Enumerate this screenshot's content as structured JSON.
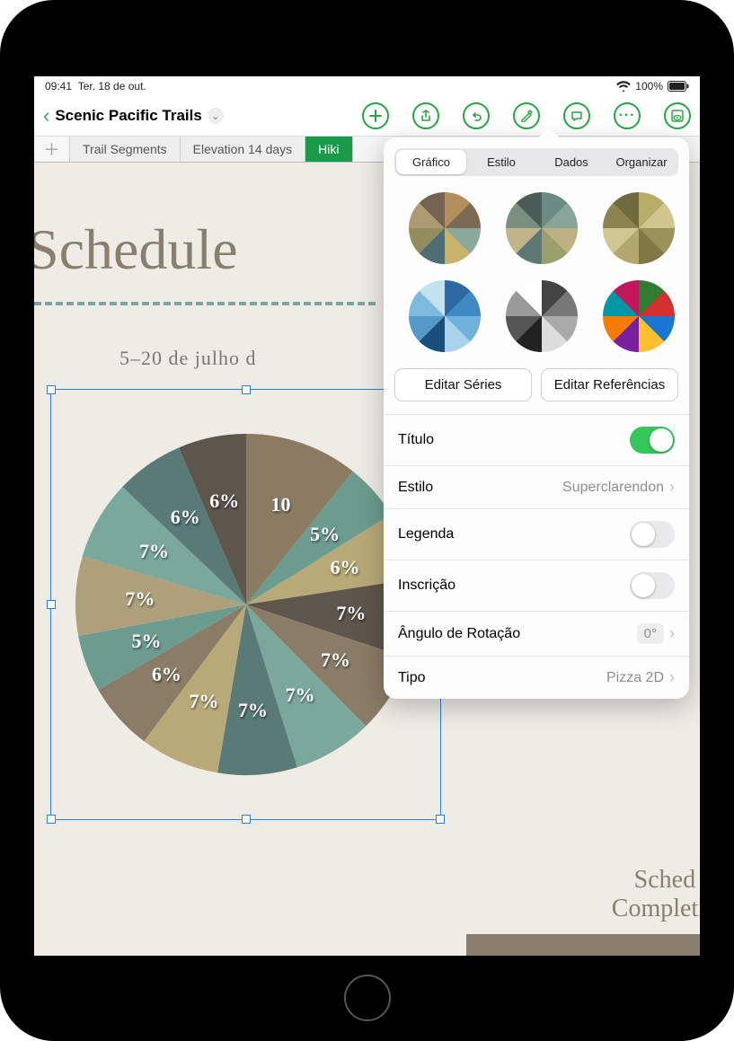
{
  "status": {
    "time": "09:41",
    "date": "Ter. 18 de out.",
    "battery": "100%"
  },
  "toolbar": {
    "doc_title": "Scenic Pacific Trails"
  },
  "sheets": {
    "tab1": "Trail Segments",
    "tab2": "Elevation 14 days",
    "tab3": "Hiki"
  },
  "canvas": {
    "title": "Schedule",
    "date": "5–20 de julho d",
    "corner": "Sched\nCompletin"
  },
  "popover": {
    "seg_chart": "Gráfico",
    "seg_style": "Estilo",
    "seg_data": "Dados",
    "seg_org": "Organizar",
    "edit_series": "Editar Séries",
    "edit_refs": "Editar Referências",
    "row_title": "Título",
    "row_style": "Estilo",
    "row_style_val": "Superclarendon",
    "row_legend": "Legenda",
    "row_insc": "Inscrição",
    "row_angle": "Ângulo de Rotação",
    "row_angle_val": "0°",
    "row_type": "Tipo",
    "row_type_val": "Pizza 2D"
  },
  "style_swatches": [
    [
      "#b28f5c",
      "#7c6b54",
      "#8aa89b",
      "#c9b36b",
      "#4f6e74",
      "#948c5e",
      "#ad9c73",
      "#736350"
    ],
    [
      "#6a8a83",
      "#89a59a",
      "#bdb184",
      "#9aa06b",
      "#5d7775",
      "#c2b48a",
      "#7a8f7e",
      "#4b5b58"
    ],
    [
      "#b7ac68",
      "#cfc68e",
      "#9a925a",
      "#7e7846",
      "#b2a86d",
      "#d0c893",
      "#8d8351",
      "#6e6a3e"
    ],
    [
      "#2d6aa3",
      "#3f8ac4",
      "#6eb2dd",
      "#a9d2ec",
      "#1a4f7c",
      "#5599c9",
      "#7fbbe0",
      "#c5e1f0"
    ],
    [
      "#444444",
      "#777777",
      "#aaaaaa",
      "#dddddd",
      "#222222",
      "#555555",
      "#999999",
      "#ffffff"
    ],
    [
      "#2e7d32",
      "#d32f2f",
      "#1976d2",
      "#fbc02d",
      "#7b1fa2",
      "#f57c00",
      "#0097a7",
      "#c2185b"
    ]
  ],
  "chart_data": {
    "type": "pie",
    "title": "",
    "slices": [
      {
        "label": "10",
        "value": 10,
        "color": "#8a7b62"
      },
      {
        "label": "5%",
        "value": 5,
        "color": "#6c9c8f"
      },
      {
        "label": "6%",
        "value": 6,
        "color": "#b8a978"
      },
      {
        "label": "7%",
        "value": 7,
        "color": "#5e564c"
      },
      {
        "label": "7%",
        "value": 7,
        "color": "#8a7c66"
      },
      {
        "label": "7%",
        "value": 7,
        "color": "#7ba89d"
      },
      {
        "label": "7%",
        "value": 7,
        "color": "#5a7a78"
      },
      {
        "label": "7%",
        "value": 7,
        "color": "#b8a978"
      },
      {
        "label": "6%",
        "value": 6,
        "color": "#8a7c66"
      },
      {
        "label": "5%",
        "value": 5,
        "color": "#6c9c8f"
      },
      {
        "label": "7%",
        "value": 7,
        "color": "#ada07a"
      },
      {
        "label": "7%",
        "value": 7,
        "color": "#7aa89c"
      },
      {
        "label": "6%",
        "value": 6,
        "color": "#5a7a78"
      },
      {
        "label": "6%",
        "value": 6,
        "color": "#5e564c"
      }
    ]
  }
}
